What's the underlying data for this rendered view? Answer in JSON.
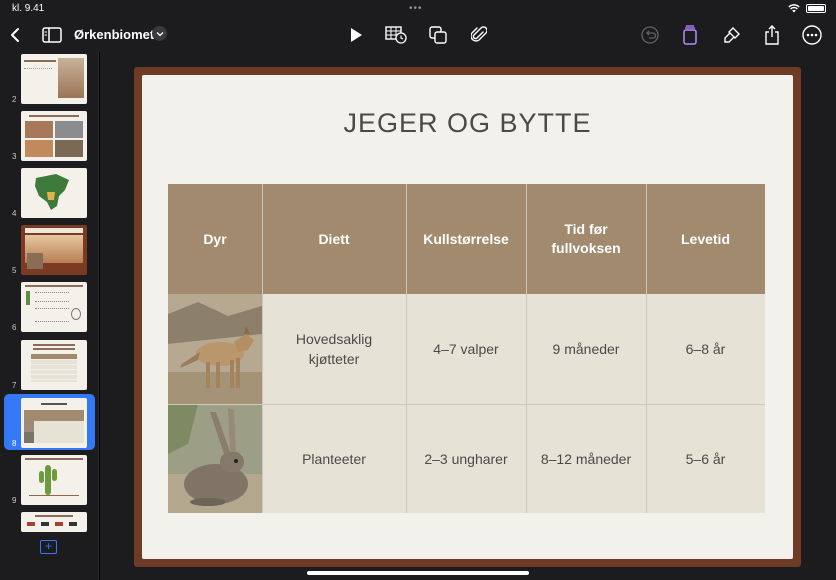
{
  "status": {
    "time": "kl. 9.41"
  },
  "toolbar": {
    "doc_title": "Ørkenbiomet"
  },
  "sidebar": {
    "slides": [
      {
        "num": "2",
        "title": "HVA ER EN ØRKEN?"
      },
      {
        "num": "3",
        "title": "VARME, KALDE, TØRRE OG FUKTIGE ØRKENER"
      },
      {
        "num": "4",
        "title": ""
      },
      {
        "num": "5",
        "title": "EN NÆRMERE TITT PÅ MOJAVEØRKENEN"
      },
      {
        "num": "6",
        "title": "PLANTE- OG DYRELIVET I MOJAVEØRKENEN"
      },
      {
        "num": "7",
        "title": "NÆRINGSKJEDEN I MOJAVEØRKENEN"
      },
      {
        "num": "8",
        "title": "JEGER OG BYTTE"
      },
      {
        "num": "9",
        "title": "HVORDAN SAGUAROKAKTUSEN SKAFFER VANN"
      },
      {
        "num": "",
        "title": "BAKGRUNNEN FOR MATNETT"
      }
    ]
  },
  "slide": {
    "title": "JEGER OG BYTTE",
    "headers": [
      "Dyr",
      "Diett",
      "Kullstørrelse",
      "Tid før fullvoksen",
      "Levetid"
    ],
    "rows": [
      {
        "animal_icon": "coyote-photo",
        "diet": "Hovedsaklig kjøtteter",
        "litter": "4–7 valper",
        "maturity": "9 måneder",
        "lifespan": "6–8 år"
      },
      {
        "animal_icon": "jackrabbit-photo",
        "diet": "Planteeter",
        "litter": "2–3 ungharer",
        "maturity": "8–12 måneder",
        "lifespan": "5–6 år"
      }
    ]
  },
  "colors": {
    "accent": "#3478f6",
    "header": "#a28a6e",
    "cell": "#e6e2d5",
    "frame": "#6d3b26",
    "slide_bg": "#f3f1ec"
  }
}
